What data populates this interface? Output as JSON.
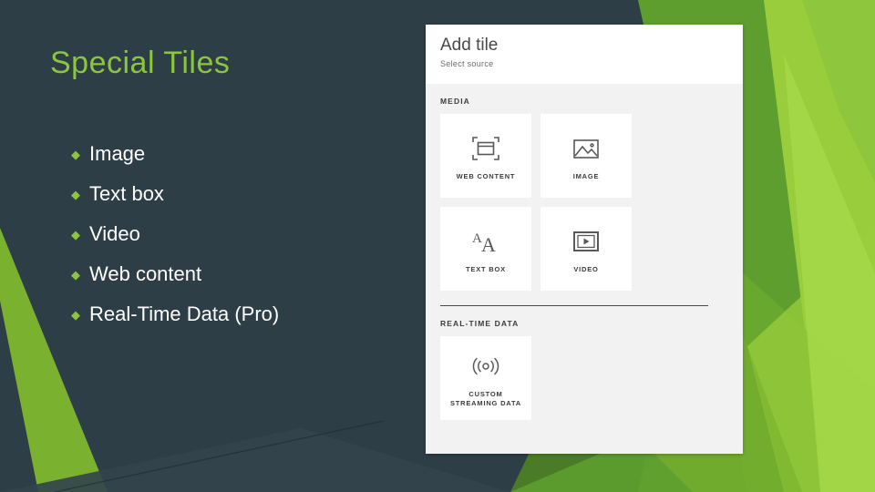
{
  "slide": {
    "title": "Special Tiles",
    "background_color": "#2d3e47",
    "accent_color": "#8cc63e",
    "bullets": [
      {
        "marker": "◆",
        "label": "Image"
      },
      {
        "marker": "◆",
        "label": "Text box"
      },
      {
        "marker": "◆",
        "label": "Video"
      },
      {
        "marker": "◆",
        "label": "Web content"
      },
      {
        "marker": "◆",
        "label": "Real-Time Data (Pro)"
      }
    ]
  },
  "dialog": {
    "title": "Add tile",
    "subtitle": "Select source",
    "sections": [
      {
        "label": "MEDIA",
        "tiles": [
          {
            "label": "WEB CONTENT",
            "icon": "web-content-icon"
          },
          {
            "label": "IMAGE",
            "icon": "image-icon"
          },
          {
            "label": "TEXT BOX",
            "icon": "text-box-icon"
          },
          {
            "label": "VIDEO",
            "icon": "video-icon"
          }
        ]
      },
      {
        "label": "REAL-TIME DATA",
        "tiles": [
          {
            "label": "CUSTOM\nSTREAMING DATA",
            "icon": "streaming-data-icon"
          }
        ]
      }
    ]
  }
}
